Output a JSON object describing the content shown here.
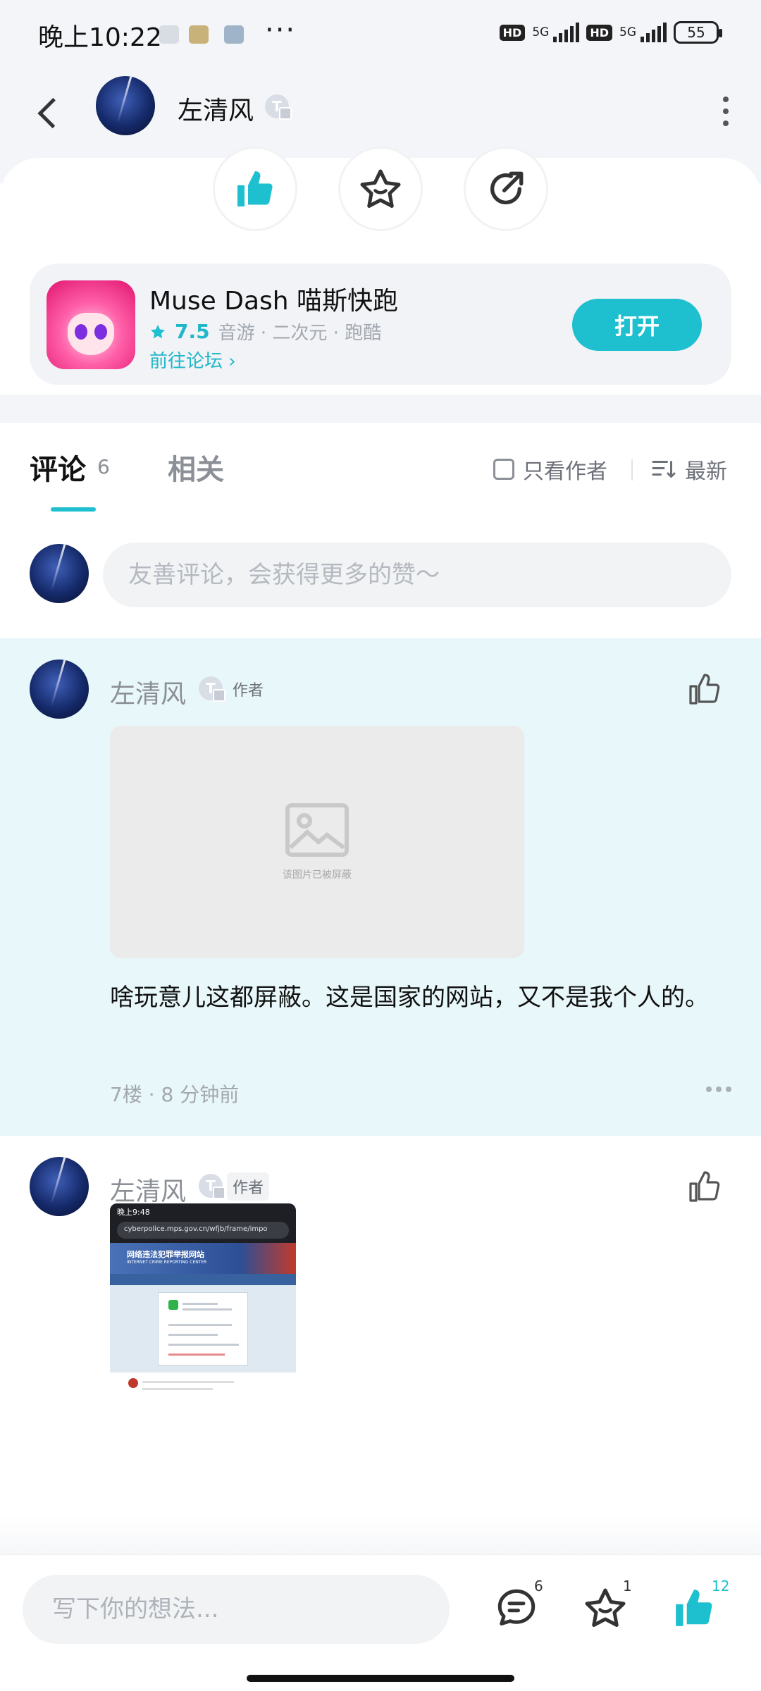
{
  "status_bar": {
    "time": "晚上10:22",
    "dots": "···",
    "network_1": "5G",
    "network_2": "5G",
    "hd_1": "HD",
    "hd_2": "HD",
    "battery": "55"
  },
  "header": {
    "user_name": "左清风",
    "badge_letter": "T",
    "icons": [
      "back-icon",
      "more-vertical-icon"
    ]
  },
  "actions": {
    "icons": [
      "thumbs-up-icon",
      "star-icon",
      "share-icon"
    ],
    "like_active_color": "#1ec0cf"
  },
  "app_card": {
    "name": "Muse Dash 喵斯快跑",
    "rating": "7.5",
    "tags": "音游 · 二次元 · 跑酷",
    "forum_link": "前往论坛",
    "open_button": "打开",
    "accent_color": "#1ec0cf"
  },
  "tabs": {
    "comments_label": "评论",
    "comments_count": "6",
    "related_label": "相关",
    "only_author_label": "只看作者",
    "sort_label": "最新"
  },
  "comment_input": {
    "placeholder": "友善评论，会获得更多的赞～"
  },
  "comments": [
    {
      "user_name": "左清风",
      "badge_letter": "T",
      "author_tag": "作者",
      "image_notice": "该图片已被屏蔽",
      "text": "啥玩意儿这都屏蔽。这是国家的网站，又不是我个人的。",
      "meta": "7楼 · 8 分钟前",
      "highlighted": true
    },
    {
      "user_name": "左清风",
      "badge_letter": "T",
      "author_tag": "作者",
      "screenshot": {
        "status_time": "晚上9:48",
        "url": "cyberpolice.mps.gov.cn/wfjb/frame/impo",
        "banner_title": "网络违法犯罪举报网站",
        "banner_subtitle": "INTERNET CRIME REPORTING CENTER"
      },
      "highlighted": false
    }
  ],
  "bottom_bar": {
    "placeholder": "写下你的想法...",
    "comment_count": "6",
    "favorite_count": "1",
    "like_count": "12"
  }
}
